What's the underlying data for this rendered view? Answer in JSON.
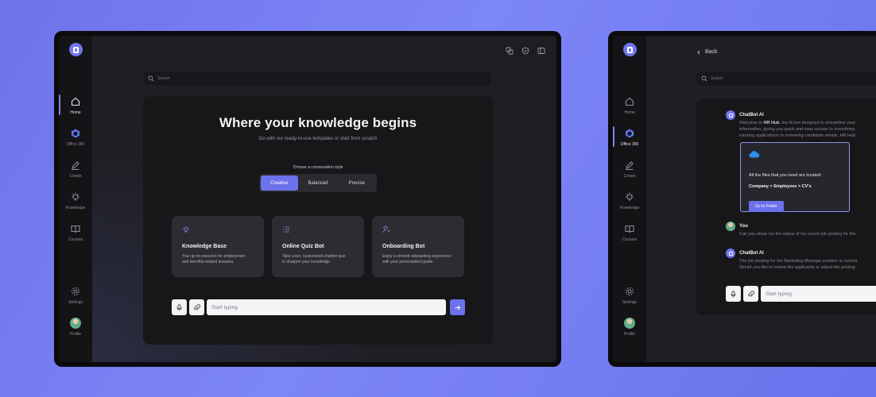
{
  "colors": {
    "accent": "#6c72ec",
    "background_gradient": [
      "#6f73ea",
      "#7d86f6"
    ],
    "surface": "#17171a",
    "sidebar": "#141417"
  },
  "sidebar": {
    "logo_icon": "hr-hub-logo-icon",
    "items": [
      {
        "label": "Home",
        "icon": "home-icon"
      },
      {
        "label": "Office 365",
        "icon": "office-365-icon"
      },
      {
        "label": "Create",
        "icon": "pencil-icon"
      },
      {
        "label": "Knowledge",
        "icon": "lightbulb-icon"
      },
      {
        "label": "Courses",
        "icon": "book-icon"
      }
    ],
    "settings_label": "Settings",
    "profile_label": "Profile"
  },
  "screen1": {
    "search_placeholder": "Search",
    "title": "Where your knowledge begins",
    "subtitle": "Go with our ready-to-use templates or start from scratch",
    "style_label": "Choose a conversation style",
    "styles": [
      "Creative",
      "Balanced",
      "Precise"
    ],
    "active_style": "Creative",
    "tiles": [
      {
        "title": "Knowledge Base",
        "desc_1": "Your go-to resource for employment",
        "desc_2": "and benefits-related answers.",
        "icon": "lightbulb-icon"
      },
      {
        "title": "Online Quiz Bot",
        "desc_1": "Take a fun, customized chatbot quiz",
        "desc_2": "to sharpen your knowledge.",
        "icon": "list-icon"
      },
      {
        "title": "Onboarding Bot",
        "desc_1": "Enjoy a smooth onboarding experience",
        "desc_2": "with your personalized guide.",
        "icon": "user-bot-icon"
      }
    ],
    "composer_placeholder": "Start typing"
  },
  "screen2": {
    "back_label": "Back",
    "search_placeholder": "Search",
    "bot_name": "ChatBot AI",
    "bot_intro_1_a": "Welcome to ",
    "bot_intro_1_b": "HR Hub",
    "bot_intro_1_c": ", the AI bot designed to streamline your",
    "bot_intro_2": "information, giving you quick and easy access to everything",
    "bot_intro_3": "tracking applications to reviewing candidate details, HR Hub",
    "files_text": "All the files that you need are located:",
    "files_path": "Company > Employees > CV's",
    "folder_button": "Go to Folder",
    "user_name": "You",
    "user_message": "Can you show me the status of my recent job posting for the",
    "bot_reply_1": "The job posting for the Marketing Manager position is current",
    "bot_reply_2": "Would you like to review the applicants or adjust the posting",
    "composer_placeholder": "Start typing"
  }
}
